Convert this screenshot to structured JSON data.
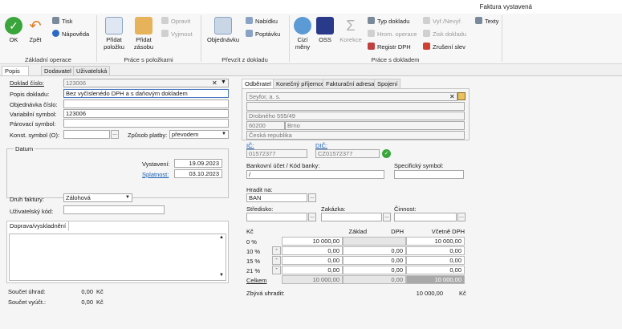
{
  "window": {
    "title": "Faktura vystavená"
  },
  "ribbon": {
    "groups": {
      "basic": "Základní operace",
      "items": "Práce s položkami",
      "transfer": "Převzít z dokladu",
      "document": "Práce s dokladem"
    },
    "ok": "OK",
    "back": "Zpět",
    "print": "Tisk",
    "help": "Nápověda",
    "add_item": "Přidat položku",
    "add_stock": "Přidat zásobu",
    "edit": "Opravit",
    "remove": "Vyjmout",
    "order": "Objednávku",
    "offer": "Nabídku",
    "demand": "Poptávku",
    "foreign": "Cizí měny",
    "oss": "OSS",
    "correction": "Korekce",
    "doc_type": "Typ dokladu",
    "mass_ops": "Hrom. operace",
    "dph_reg": "Registr DPH",
    "calc": "Vyř./Nevyř.",
    "profit": "Zisk dokladu",
    "cancel_disc": "Zrušení slev",
    "texts": "Texty"
  },
  "tabs": [
    "Popis dokladu",
    "Dodavatel",
    "Uživatelská pole"
  ],
  "form": {
    "doc_no_label": "Doklad číslo:",
    "doc_no": "123006",
    "desc_label": "Popis dokladu:",
    "desc": "Bez vyčíslenédo DPH a s daňovým dokladem",
    "order_no_label": "Objednávka číslo:",
    "var_sym_label": "Variabilní symbol:",
    "var_sym": "123006",
    "pair_sym_label": "Párovací symbol:",
    "const_sym_label": "Konst. symbol (O):",
    "payment_label": "Způsob platby:",
    "payment": "převodem",
    "date_group": "Datum",
    "issued_label": "Vystavení:",
    "issued": "19.09.2023",
    "due_label": "Splatnost:",
    "due": "03.10.2023",
    "type_label": "Druh faktury:",
    "type": "Zálohová",
    "user_code_label": "Uživatelský kód:",
    "transport_tab": "Doprava/vyskladnění",
    "sum_paid_label": "Součet úhrad:",
    "sum_paid": "0,00",
    "sum_billed_label": "Součet vyúčt.:",
    "sum_billed": "0,00",
    "currency": "Kč"
  },
  "partner": {
    "tabs": [
      "Odběratel",
      "Konečný příjemce",
      "Fakturační adresa",
      "Spojení"
    ],
    "name": "Seyfor, a. s.",
    "street": "Drobného 555/49",
    "zip": "60200",
    "city": "Brno",
    "country": "Česká republika",
    "ico_label": "IČ:",
    "ico": "01572377",
    "dic_label": "DIČ:",
    "dic": "CZ01572377",
    "bank_label": "Bankovní účet / Kód banky:",
    "bank": "/",
    "spec_sym_label": "Specifický symbol:",
    "pay_by_label": "Hradit na:",
    "pay_by": "BAN",
    "center_label": "Středisko:",
    "contract_label": "Zakázka:",
    "activity_label": "Činnost:"
  },
  "vat": {
    "col_rate": "Kč",
    "col_base": "Základ",
    "col_vat": "DPH",
    "col_total": "Včetně DPH",
    "rows": [
      {
        "rate": "0 %",
        "base": "10 000,00",
        "vat": "",
        "total": "10 000,00"
      },
      {
        "rate": "10 %",
        "base": "0,00",
        "vat": "0,00",
        "total": "0,00"
      },
      {
        "rate": "15 %",
        "base": "0,00",
        "vat": "0,00",
        "total": "0,00"
      },
      {
        "rate": "21 %",
        "base": "0,00",
        "vat": "0,00",
        "total": "0,00"
      }
    ],
    "total_label": "Celkem",
    "total_base": "10 000,00",
    "total_vat": "0,00",
    "total_total": "10 000,00",
    "remaining_label": "Zbývá uhradit:",
    "remaining": "10 000,00",
    "currency": "Kč"
  }
}
